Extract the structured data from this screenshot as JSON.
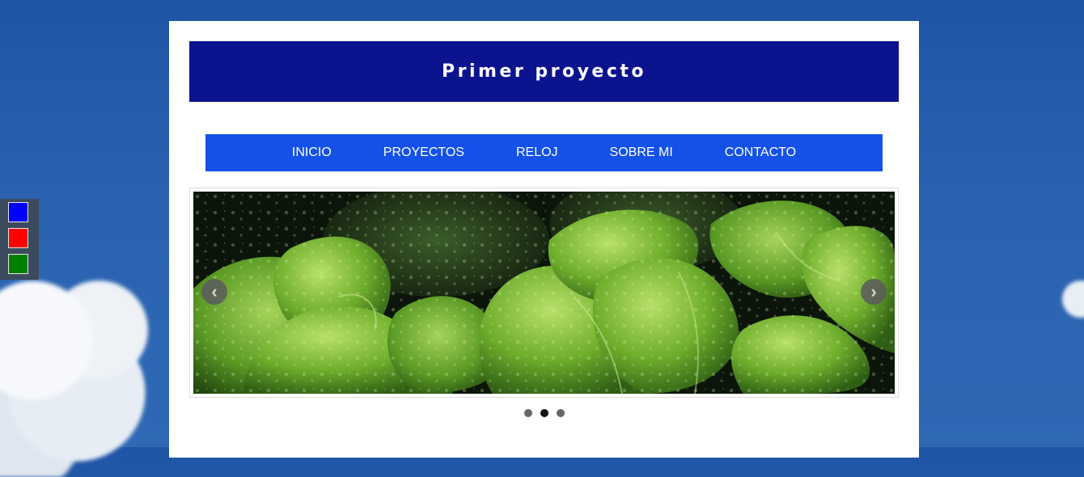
{
  "site": {
    "title": "Primer proyecto"
  },
  "nav": {
    "items": [
      {
        "label": "INICIO"
      },
      {
        "label": "PROYECTOS"
      },
      {
        "label": "RELOJ"
      },
      {
        "label": "SOBRE MI"
      },
      {
        "label": "CONTACTO"
      }
    ]
  },
  "theme_switcher": {
    "swatches": [
      {
        "name": "blue",
        "color": "#0000ff"
      },
      {
        "name": "red",
        "color": "#ff0000"
      },
      {
        "name": "green",
        "color": "#008000"
      }
    ]
  },
  "slider": {
    "slide_count": 3,
    "active_index": 1,
    "prev_icon": "chevron-left-icon",
    "next_icon": "chevron-right-icon",
    "prev_glyph": "‹",
    "next_glyph": "›",
    "image": "green-leaves-with-water-drops"
  },
  "colors": {
    "header_bg": "#0c138f",
    "nav_bg": "#1451e8",
    "page_bg": "#ffffff",
    "sky": "#2a62b0"
  }
}
